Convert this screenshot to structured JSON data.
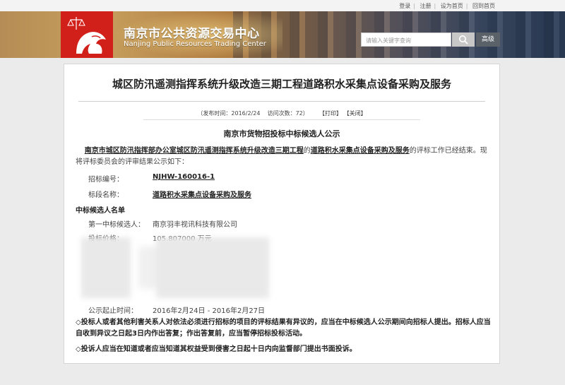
{
  "top_links": [
    "登录",
    "注册",
    "设为首页",
    "回到首页"
  ],
  "site": {
    "name_cn": "南京市公共资源交易中心",
    "name_en": "Nanjing Public Resources Trading Center",
    "search_placeholder": "请输入关键字查询",
    "advanced_label": "高级"
  },
  "colors": {
    "logo_red": "#d11f1a",
    "advanced_btn": "#5a6168"
  },
  "article": {
    "title": "城区防汛遥测指挥系统升级改造三期工程道路积水采集点设备采购及服务",
    "publish_label": "（发布时间：",
    "publish_date": "2016/2/24",
    "visits_label": "访问次数：",
    "visits": "72",
    "close_paren": "）",
    "print_label": "【打印】",
    "close_label": "【关闭】",
    "notice_title": "南京市货物招投标中标候选人公示",
    "intro_bold": "南京市城区防汛指挥部办公室城区防汛遥测指挥系统升级改造三期工程",
    "intro_de": "的",
    "intro_bold2": "道路积水采集点设备采购及服务",
    "intro_rest": "的评标工作已经结束。现将评标委员会的评审结果公示如下：",
    "bid_no_label": "招标编号：",
    "bid_no": "NJHW-160016-1",
    "project_label": "标段名称：",
    "project_name": "道路积水采集点设备采购及服务",
    "candidates_heading": "中标候选人名单",
    "first_label": "第一中标候选人：",
    "first_value": "南京羽丰视讯科技有限公司",
    "price_label": "投标价格：",
    "price_value": "105.807000 万元",
    "period_label": "公示起止时间：",
    "period_value": "2016年2月24日 - 2016年2月27日",
    "note1": "◇投标人或者其他利害关系人对依法必须进行招标的项目的评标结果有异议的，应当在中标候选人公示期间向招标人提出。招标人应当自收到异议之日起3日内作出答复；作出答复前，应当暂停招标投标活动。",
    "note2": "◇投诉人应当在知道或者应当知道其权益受到侵害之日起十日内向监督部门提出书面投诉。"
  }
}
